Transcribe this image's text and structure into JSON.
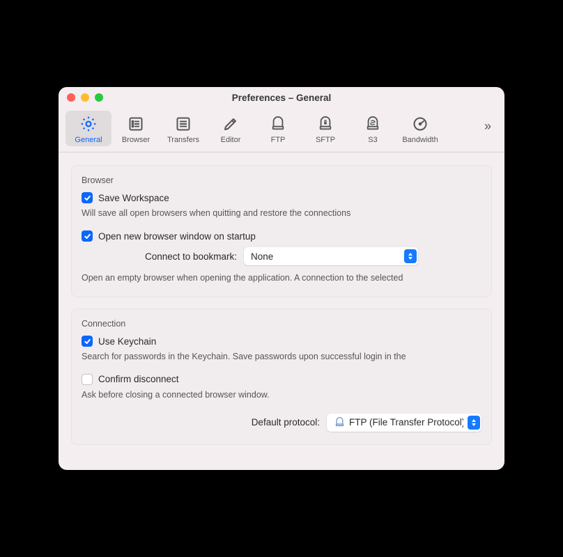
{
  "window": {
    "title": "Preferences – General"
  },
  "toolbar": {
    "items": [
      {
        "label": "General"
      },
      {
        "label": "Browser"
      },
      {
        "label": "Transfers"
      },
      {
        "label": "Editor"
      },
      {
        "label": "FTP"
      },
      {
        "label": "SFTP"
      },
      {
        "label": "S3"
      },
      {
        "label": "Bandwidth"
      }
    ],
    "overflow_glyph": "»"
  },
  "sections": {
    "browser": {
      "title": "Browser",
      "save_workspace": {
        "label": "Save Workspace",
        "desc": "Will save all open browsers when quitting and restore the connections",
        "checked": true
      },
      "open_on_startup": {
        "label": "Open new browser window on startup",
        "checked": true,
        "bookmark_label": "Connect to bookmark:",
        "bookmark_value": "None",
        "desc": "Open an empty browser when opening the application. A connection to the selected"
      }
    },
    "connection": {
      "title": "Connection",
      "use_keychain": {
        "label": "Use Keychain",
        "desc": "Search for passwords in the Keychain. Save passwords upon successful login in the",
        "checked": true
      },
      "confirm_disconnect": {
        "label": "Confirm disconnect",
        "desc": "Ask before closing a connected browser window.",
        "checked": false
      },
      "default_protocol": {
        "label": "Default protocol:",
        "value": "FTP (File Transfer Protocol)"
      }
    }
  }
}
